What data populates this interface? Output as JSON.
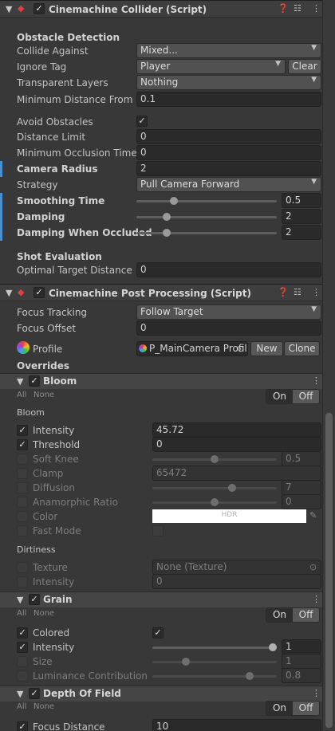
{
  "collider": {
    "title": "Cinemachine Collider (Script)",
    "obstacle_detection": "Obstacle Detection",
    "collide_against_label": "Collide Against",
    "collide_against_value": "Mixed...",
    "ignore_tag_label": "Ignore Tag",
    "ignore_tag_value": "Player",
    "clear_label": "Clear",
    "transparent_layers_label": "Transparent Layers",
    "transparent_layers_value": "Nothing",
    "min_distance_label": "Minimum Distance From Target",
    "min_distance_value": "0.1",
    "avoid_obstacles_label": "Avoid Obstacles",
    "distance_limit_label": "Distance Limit",
    "distance_limit_value": "0",
    "min_occlusion_label": "Minimum Occlusion Time",
    "min_occlusion_value": "0",
    "camera_radius_label": "Camera Radius",
    "camera_radius_value": "2",
    "strategy_label": "Strategy",
    "strategy_value": "Pull Camera Forward",
    "smoothing_label": "Smoothing Time",
    "smoothing_value": "0.5",
    "damping_label": "Damping",
    "damping_value": "2",
    "damping_occluded_label": "Damping When Occluded",
    "damping_occluded_value": "2",
    "shot_evaluation": "Shot Evaluation",
    "optimal_distance_label": "Optimal Target Distance",
    "optimal_distance_value": "0"
  },
  "post": {
    "title": "Cinemachine Post Processing (Script)",
    "focus_tracking_label": "Focus Tracking",
    "focus_tracking_value": "Follow Target",
    "focus_offset_label": "Focus Offset",
    "focus_offset_value": "0",
    "profile_label": "Profile",
    "profile_value": "P_MainCamera Profile",
    "new_label": "New",
    "clone_label": "Clone",
    "overrides_label": "Overrides"
  },
  "bloom": {
    "title": "Bloom",
    "all": "All",
    "none": "None",
    "on": "On",
    "off": "Off",
    "section_bloom": "Bloom",
    "intensity_label": "Intensity",
    "intensity_value": "45.72",
    "threshold_label": "Threshold",
    "threshold_value": "0",
    "soft_knee_label": "Soft Knee",
    "soft_knee_value": "0.5",
    "clamp_label": "Clamp",
    "clamp_value": "65472",
    "diffusion_label": "Diffusion",
    "diffusion_value": "7",
    "anamorphic_label": "Anamorphic Ratio",
    "anamorphic_value": "0",
    "color_label": "Color",
    "hdr_label": "HDR",
    "fast_mode_label": "Fast Mode",
    "section_dirtiness": "Dirtiness",
    "texture_label": "Texture",
    "texture_value": "None (Texture)",
    "dirt_intensity_label": "Intensity",
    "dirt_intensity_value": "0"
  },
  "grain": {
    "title": "Grain",
    "all": "All",
    "none": "None",
    "on": "On",
    "off": "Off",
    "colored_label": "Colored",
    "intensity_label": "Intensity",
    "intensity_value": "1",
    "size_label": "Size",
    "size_value": "1",
    "lum_label": "Luminance Contribution",
    "lum_value": "0.8"
  },
  "dof": {
    "title": "Depth Of Field",
    "all": "All",
    "none": "None",
    "on": "On",
    "off": "Off",
    "focus_distance_label": "Focus Distance",
    "focus_distance_value": "10"
  },
  "sliders": {
    "smoothing_fraction": 0.25,
    "damping_fraction": 0.2,
    "damping_occluded_fraction": 0.2,
    "soft_knee_fraction": 0.5,
    "diffusion_fraction": 0.65,
    "anamorphic_fraction": 0.5,
    "grain_intensity_fraction": 1.0,
    "grain_size_fraction": 0.25,
    "grain_lum_fraction": 0.8
  }
}
